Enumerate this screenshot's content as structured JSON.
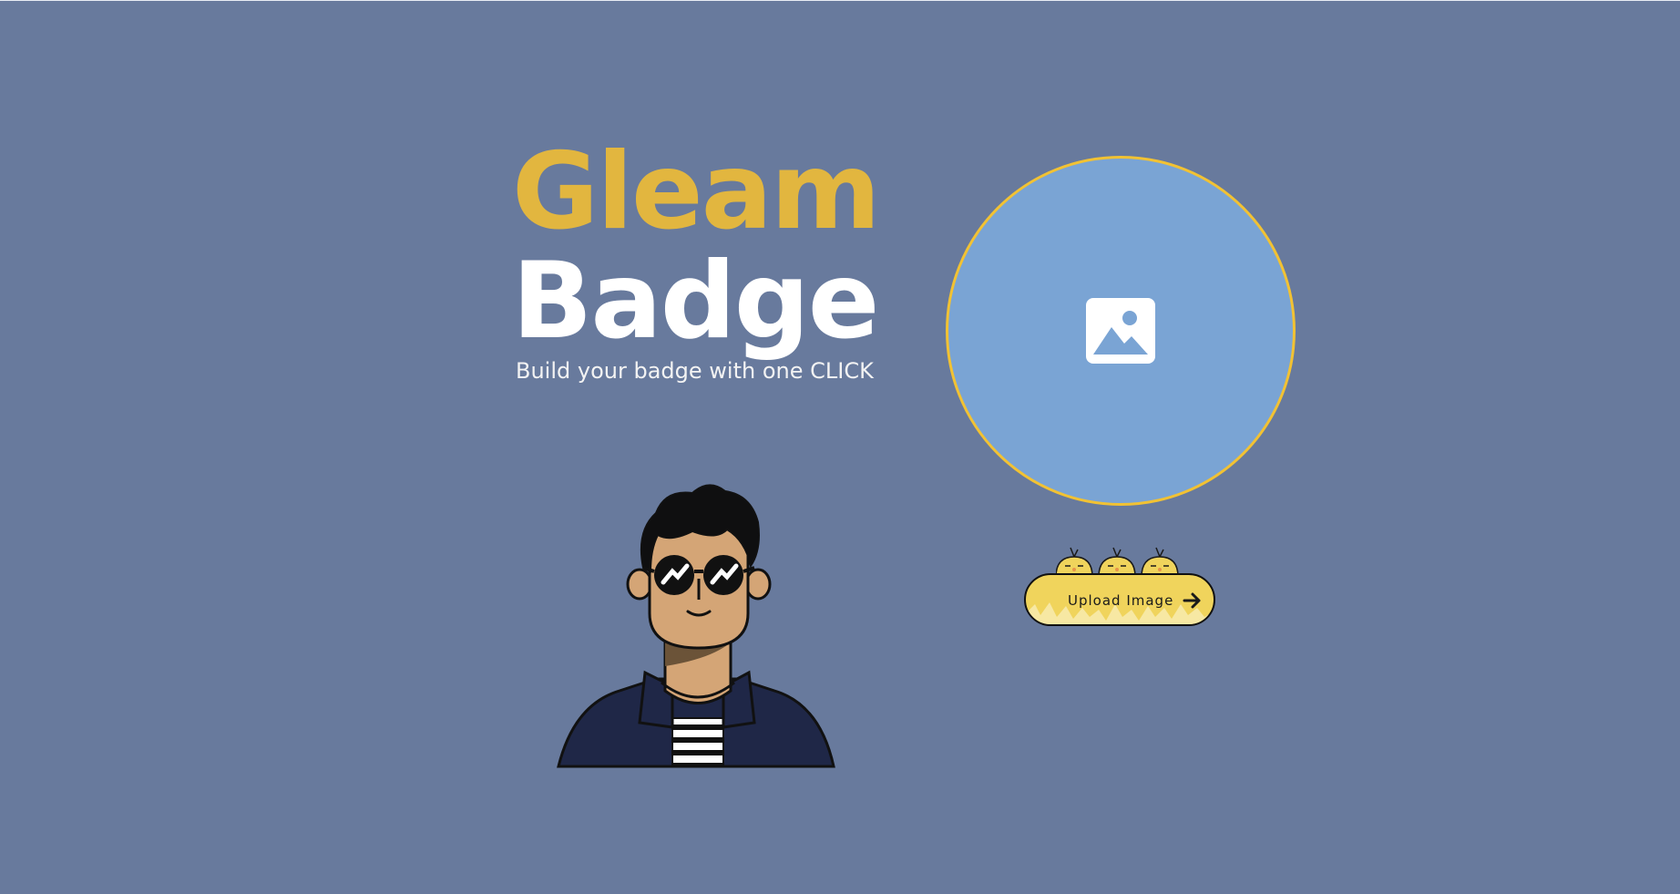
{
  "hero": {
    "title_line1": "Gleam",
    "title_line2": "Badge",
    "subtitle": "Build your badge with one CLICK"
  },
  "badge_preview": {
    "icon": "image-placeholder-icon",
    "border_color": "#f2c233",
    "fill_color": "#7aa4d4"
  },
  "upload": {
    "label": "Upload Image",
    "icon": "arrow-right-icon",
    "decoration": "chicks"
  },
  "illustration": {
    "icon": "avatar-man-sunglasses"
  },
  "colors": {
    "background": "#687a9d",
    "accent_gold": "#e2b63f",
    "button_yellow": "#f0d45c"
  }
}
